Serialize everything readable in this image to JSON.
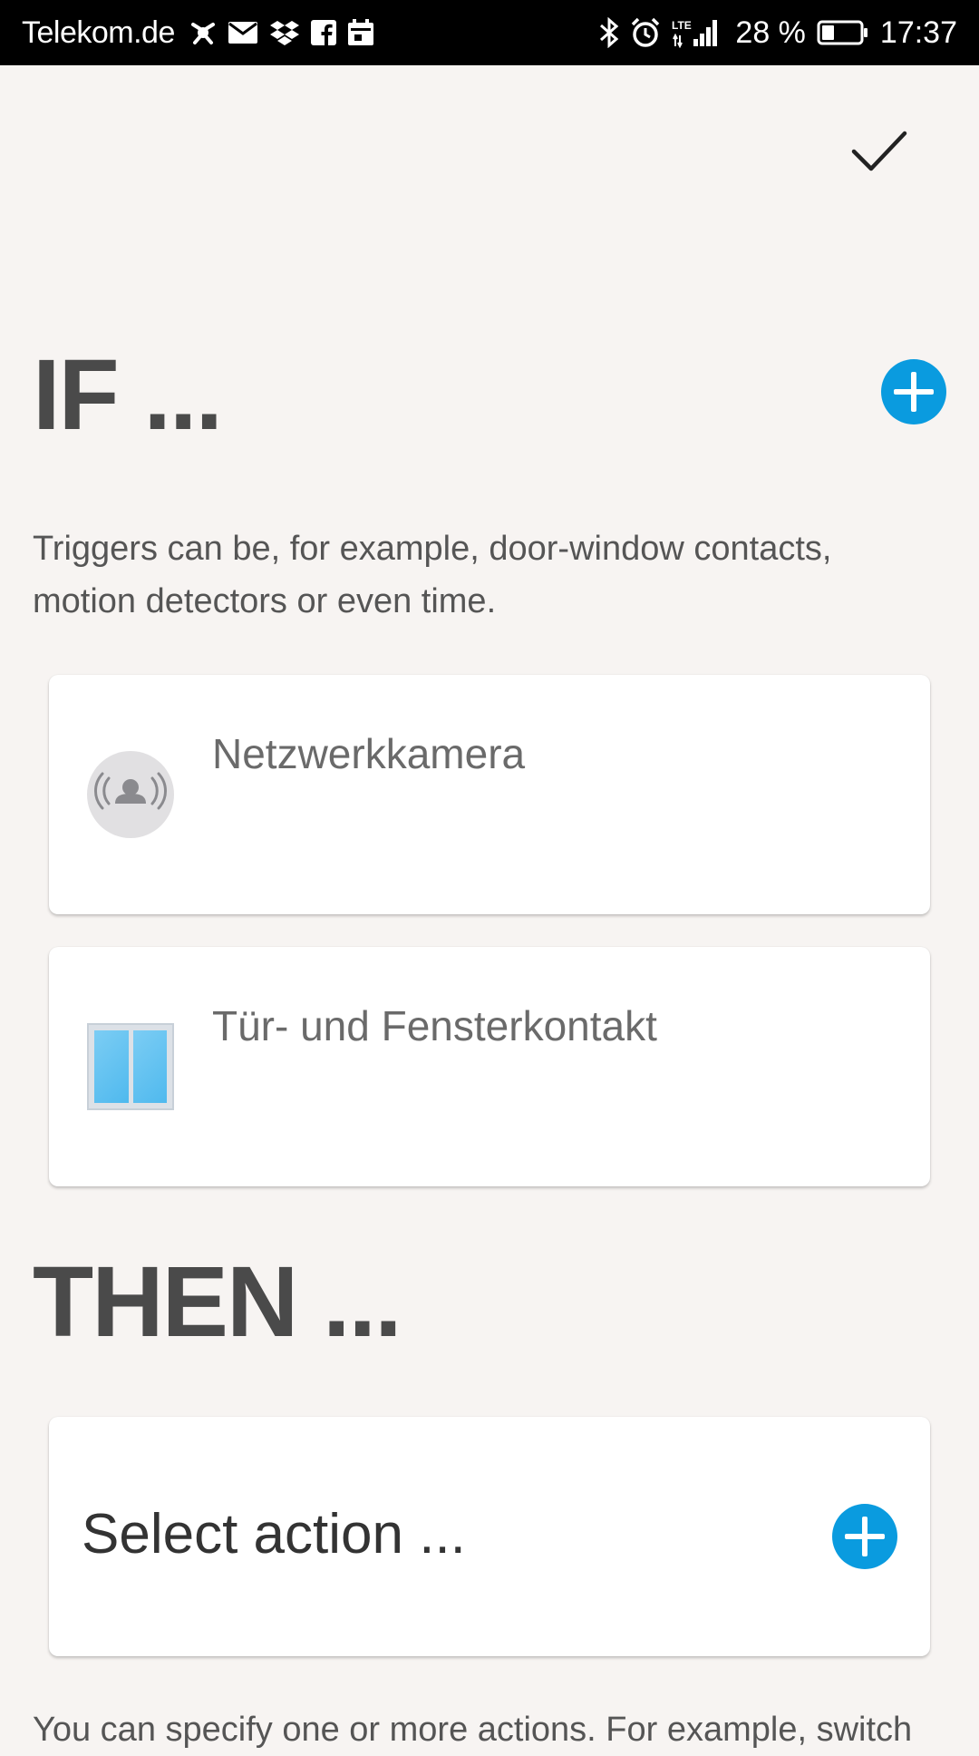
{
  "status_bar": {
    "carrier": "Telekom.de",
    "network": "LTE",
    "battery": "28 %",
    "time": "17:37",
    "left_icons": [
      "notification-app-icon",
      "mail-icon",
      "dropbox-icon",
      "facebook-icon",
      "calendar-icon"
    ],
    "right_icons": [
      "bluetooth-icon",
      "alarm-icon",
      "lte-signal-icon",
      "battery-icon"
    ]
  },
  "toolbar": {
    "confirm_icon": "checkmark-icon"
  },
  "if_section": {
    "title": "IF ...",
    "description": "Triggers can be, for example, door-window contacts, motion detectors or even time.",
    "triggers": [
      {
        "label": "Netzwerkkamera",
        "icon": "network-camera-icon"
      },
      {
        "label": "Tür- und Fensterkontakt",
        "icon": "door-window-contact-icon"
      }
    ]
  },
  "then_section": {
    "title": "THEN ...",
    "action_placeholder": "Select action ...",
    "description": "You can specify one or more actions. For example, switch"
  },
  "colors": {
    "accent": "#0a9bdf",
    "background": "#f7f4f2",
    "title_text": "#4a4a4a"
  }
}
